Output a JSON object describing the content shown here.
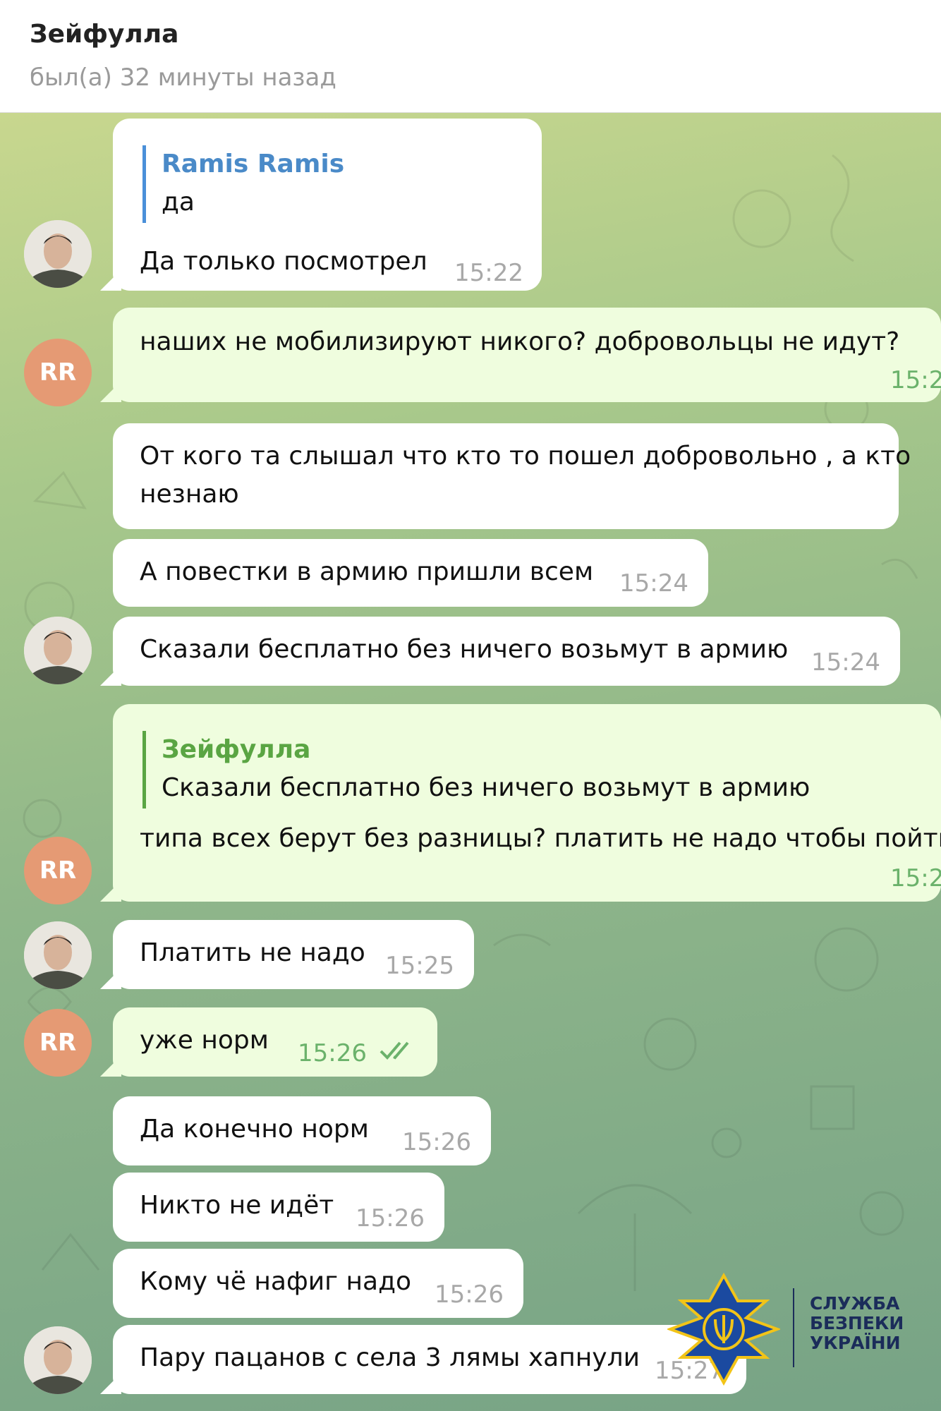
{
  "header": {
    "title": "Зейфулла",
    "status": "был(а) 32 минуты назад"
  },
  "contacts": {
    "rr_initials": "RR"
  },
  "colors": {
    "reply_blue": "#4a90d9",
    "reply_green": "#5aa543",
    "outgoing_time": "#6bb26b",
    "avatar_rr": "#e59a74",
    "logo_blue": "#1b4aa0",
    "logo_gold": "#f2c418"
  },
  "messages": [
    {
      "reply_name": "Ramis Ramis",
      "reply_text": "да",
      "text": "Да только посмотрел",
      "time": "15:22"
    },
    {
      "text": "наших не мобилизируют никого? добровольцы не идут?",
      "time": "15:2"
    },
    {
      "text": "От кого та слышал что кто то пошел добровольно , а кто",
      "text2": "незнаю"
    },
    {
      "text": "А повестки в армию пришли всем",
      "time": "15:24"
    },
    {
      "text": "Сказали бесплатно без ничего возьмут в армию",
      "time": "15:24"
    },
    {
      "reply_name": "Зейфулла",
      "reply_text": "Сказали бесплатно без ничего возьмут в армию",
      "text": "типа всех берут без разницы? платить не надо чтобы пойти",
      "time": "15:2"
    },
    {
      "text": "Платить не надо",
      "time": "15:25"
    },
    {
      "text": "уже норм",
      "time": "15:26",
      "icon": "double-check-icon"
    },
    {
      "text": "Да конечно норм",
      "time": "15:26"
    },
    {
      "text": "Никто не идёт",
      "time": "15:26"
    },
    {
      "text": "Кому чё нафиг надо",
      "time": "15:26"
    },
    {
      "text": "Пару пацанов с села 3 лямы хапнули",
      "time": "15:27"
    }
  ],
  "watermark": {
    "line1": "СЛУЖБА",
    "line2": "БЕЗПЕКИ",
    "line3": "УКРАЇНИ",
    "icon": "ssu-emblem-icon"
  }
}
